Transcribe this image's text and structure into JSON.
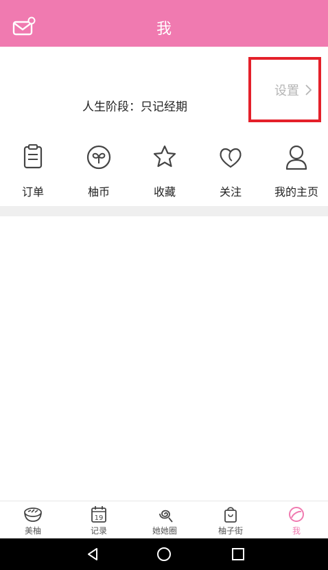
{
  "header": {
    "title": "我",
    "mail_icon": "mail-icon"
  },
  "profile": {
    "life_stage": "人生阶段：只记经期",
    "settings_label": "设置"
  },
  "quick_actions": [
    {
      "label": "订单",
      "icon": "order-icon"
    },
    {
      "label": "柚币",
      "icon": "coin-icon"
    },
    {
      "label": "收藏",
      "icon": "star-icon"
    },
    {
      "label": "关注",
      "icon": "heart-icon"
    },
    {
      "label": "我的主页",
      "icon": "user-icon"
    }
  ],
  "tabs": [
    {
      "label": "美柚",
      "icon": "bowl-icon"
    },
    {
      "label": "记录",
      "icon": "calendar-icon",
      "day": "19"
    },
    {
      "label": "她她圈",
      "icon": "swirl-icon"
    },
    {
      "label": "柚子街",
      "icon": "shopping-bag-icon"
    },
    {
      "label": "我",
      "icon": "profile-icon",
      "active": true
    }
  ],
  "colors": {
    "brand": "#f07ab0",
    "highlight": "#e4202a"
  }
}
